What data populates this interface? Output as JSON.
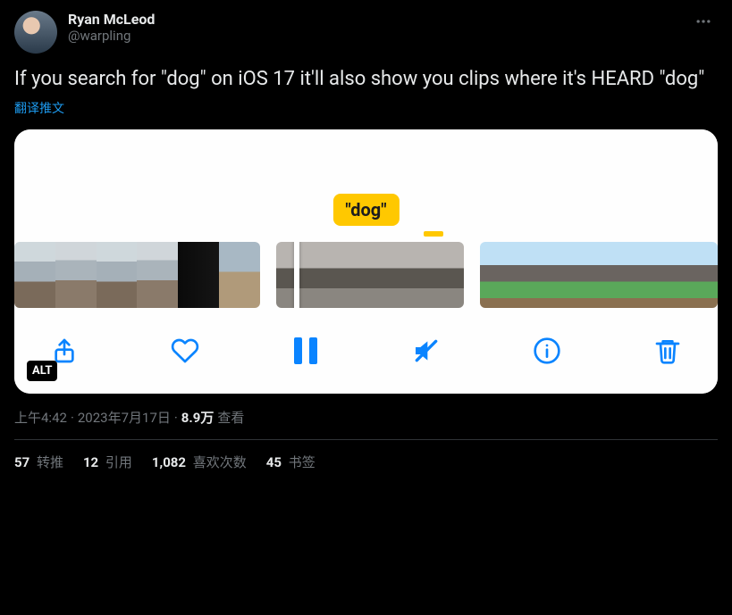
{
  "author": {
    "display_name": "Ryan McLeod",
    "handle": "@warpling"
  },
  "tweet_text": "If you search for \"dog\" on iOS 17 it'll also show you clips where it's HEARD \"dog\"",
  "translate_label": "翻译推文",
  "media": {
    "search_chip": "\"dog\"",
    "alt_badge": "ALT"
  },
  "meta": {
    "time": "上午4:42",
    "separator": " · ",
    "date": "2023年7月17日",
    "views_value": "8.9万",
    "views_label": " 查看"
  },
  "stats": {
    "retweets_value": "57",
    "retweets_label": " 转推",
    "quotes_value": "12",
    "quotes_label": " 引用",
    "likes_value": "1,082",
    "likes_label": " 喜欢次数",
    "bookmarks_value": "45",
    "bookmarks_label": " 书签"
  }
}
